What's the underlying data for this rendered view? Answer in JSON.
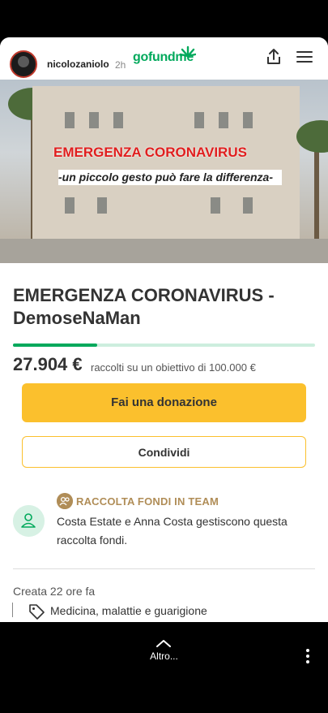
{
  "story": {
    "username": "nicolozaniolo",
    "time": "2h"
  },
  "header": {
    "logo_text": "gofundme",
    "share_icon": "share-icon",
    "menu_icon": "menu-icon"
  },
  "hero": {
    "title": "EMERGENZA CORONAVIRUS",
    "subtitle": "-un piccolo gesto può fare la differenza-"
  },
  "campaign": {
    "title": "EMERGENZA CORONAVIRUS - DemoseNaMan",
    "raised": "27.904 €",
    "goal_caption": "raccolti su un obiettivo di 100.000 €",
    "progress_fraction": 0.279
  },
  "actions": {
    "donate": "Fai una donazione",
    "share": "Condividi"
  },
  "team": {
    "label": "RACCOLTA FONDI IN TEAM",
    "organizers": "Costa Estate e Anna Costa gestiscono questa raccolta fondi."
  },
  "meta": {
    "created": "Creata 22 ore fa",
    "category": "Medicina, malattie e guarigione"
  },
  "footer": {
    "more_label": "Altro..."
  },
  "colors": {
    "brand_green": "#02a95c",
    "donate_yellow": "#fbc02d",
    "team_gold": "#b08d57"
  }
}
